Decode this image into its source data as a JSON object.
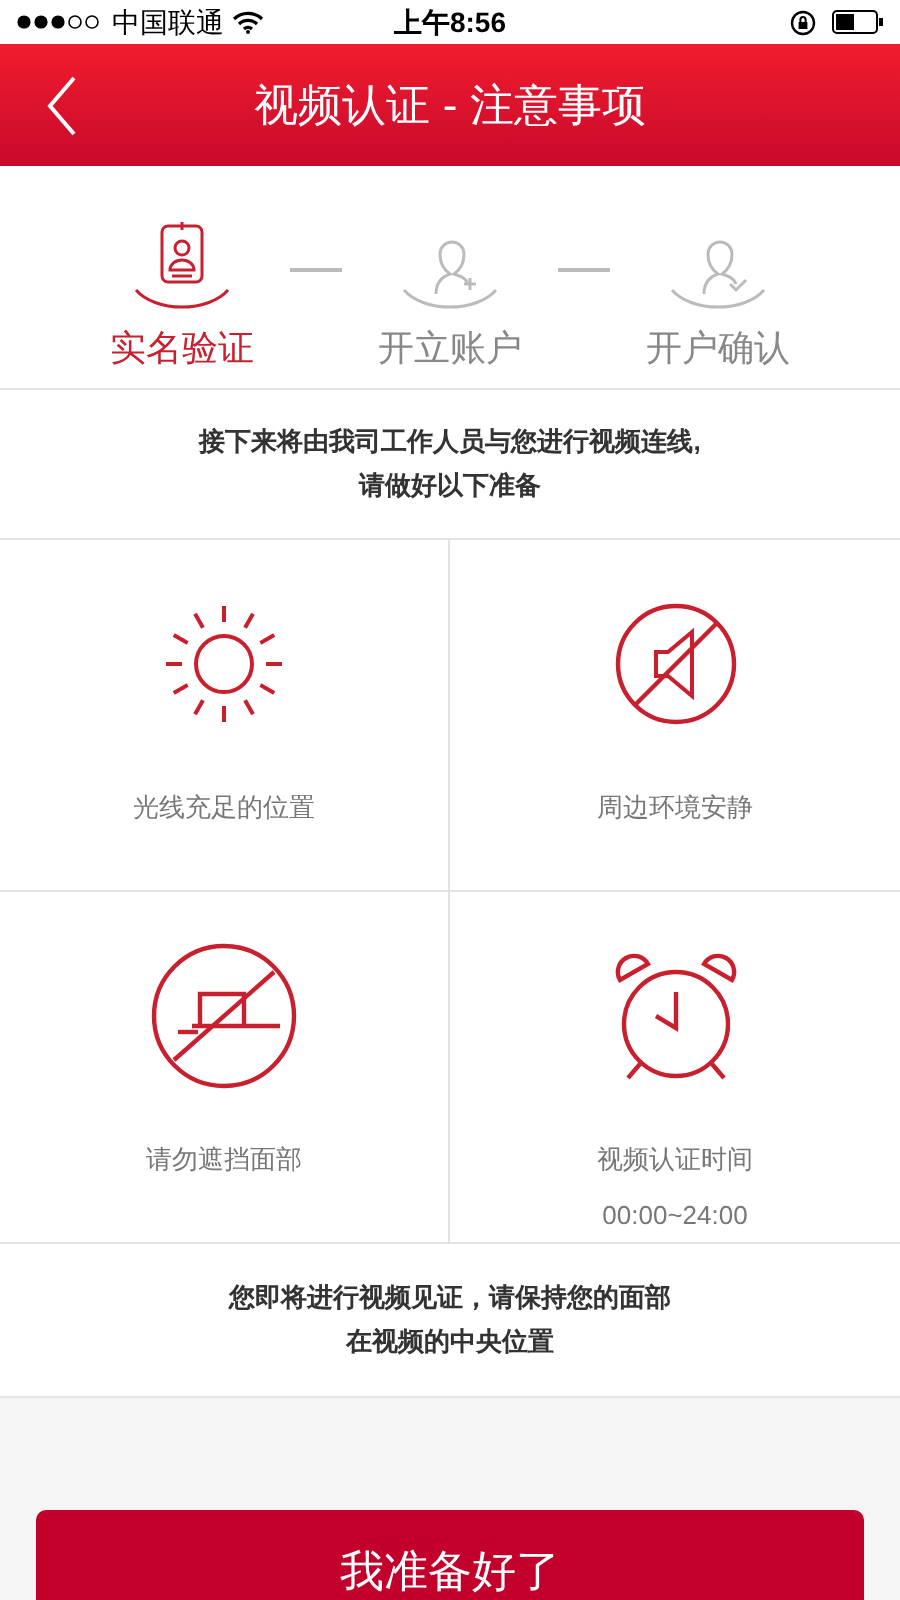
{
  "status_bar": {
    "carrier": "中国联通",
    "time": "上午8:56"
  },
  "header": {
    "title": "视频认证 - 注意事项"
  },
  "steps": [
    {
      "kind": "id-card",
      "label": "实名验证",
      "selected": true
    },
    {
      "kind": "add-user",
      "label": "开立账户",
      "selected": false
    },
    {
      "kind": "confirm-user",
      "label": "开户确认",
      "selected": false
    }
  ],
  "intro": [
    "接下来将由我司工作人员与您进行视频连线,",
    "请做好以下准备"
  ],
  "tips": [
    {
      "kind": "sun",
      "label": "光线充足的位置"
    },
    {
      "kind": "mute",
      "label": "周边环境安静"
    },
    {
      "kind": "no-cover",
      "label": "请勿遮挡面部"
    },
    {
      "kind": "alarm",
      "label": "视频认证时间",
      "subtext": "00:00~24:00"
    }
  ],
  "notice": [
    "您即将进行视频见证，请保持您的面部",
    "在视频的中央位置"
  ],
  "primary_button": "我准备好了"
}
